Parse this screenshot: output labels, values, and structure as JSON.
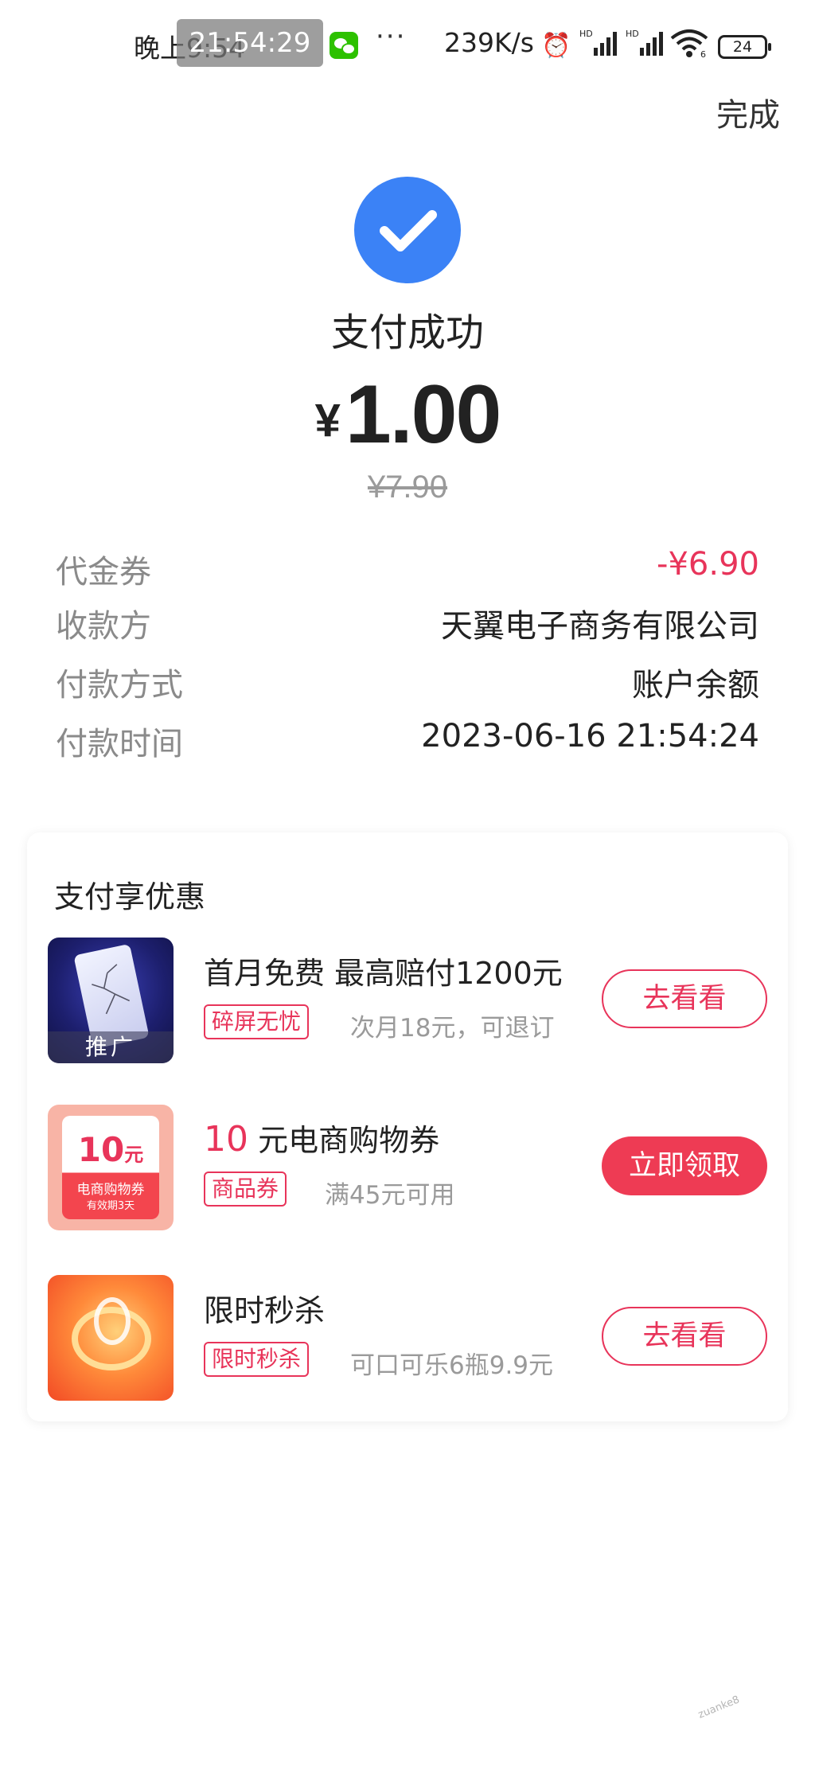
{
  "status_bar": {
    "time": "晚上9:54",
    "overlay_clock": "21:54:29",
    "more": "···",
    "net_speed": "239K/s",
    "hd1": "HD",
    "hd2": "HD",
    "wifi_sub": "6",
    "battery": "24"
  },
  "header": {
    "done_label": "完成"
  },
  "payment": {
    "title": "支付成功",
    "currency": "¥",
    "amount": "1.00",
    "original_price": "¥7.90"
  },
  "details": [
    {
      "label": "代金券",
      "value": "-¥6.90",
      "highlight": true
    },
    {
      "label": "收款方",
      "value": "天翼电子商务有限公司"
    },
    {
      "label": "付款方式",
      "value": "账户余额"
    },
    {
      "label": "付款时间",
      "value": "2023-06-16 21:54:24"
    }
  ],
  "promo": {
    "title": "支付享优惠",
    "items": [
      {
        "title": "首月免费  最高赔付1200元",
        "tag": "碎屏无忧",
        "subtitle": "次月18元，可退订",
        "thumb_label": "推广",
        "button": "去看看"
      },
      {
        "title_highlight": "10",
        "title": "元电商购物券",
        "tag": "商品券",
        "subtitle": "满45元可用",
        "thumb_amount": "10",
        "thumb_unit": "元",
        "thumb_name": "电商购物券",
        "thumb_valid": "有效期3天",
        "button": "立即领取"
      },
      {
        "title": "限时秒杀",
        "tag": "限时秒杀",
        "subtitle": "可口可乐6瓶9.9元",
        "button": "去看看"
      }
    ]
  },
  "colors": {
    "accent_red": "#e8345a",
    "check_blue": "#3b82f6"
  }
}
